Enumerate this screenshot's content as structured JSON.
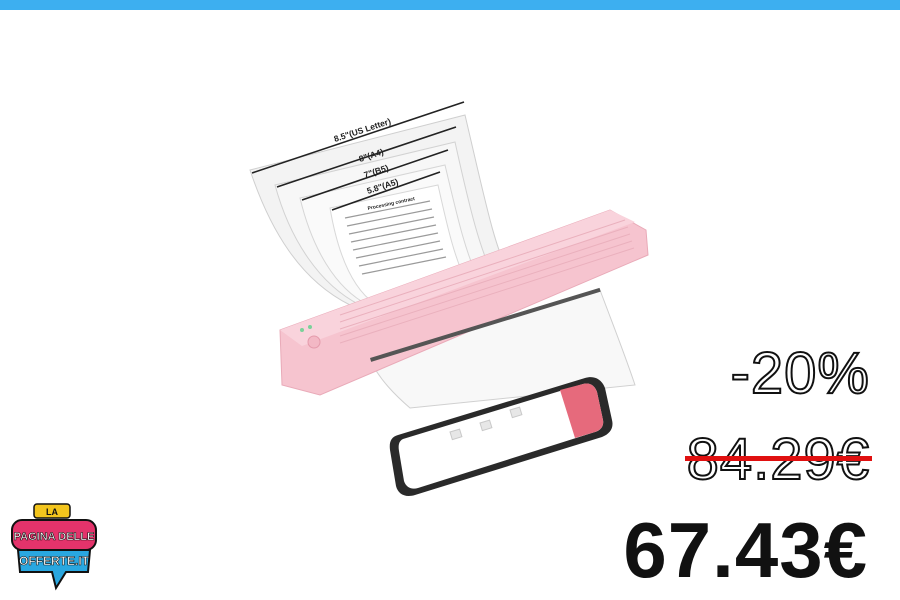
{
  "product": {
    "image_icon": "portable-printer-with-smartphone",
    "labels": {
      "us_letter": "8.5\"(US Letter)",
      "a4": "8\"(A4)",
      "b5": "7\"(B5)",
      "a5": "5.8\"(A5)",
      "doc_title": "Processing contract"
    }
  },
  "pricing": {
    "discount": "-20%",
    "old_price": "84.29€",
    "new_price": "67.43€"
  },
  "logo": {
    "line1": "LA",
    "line2": "PAGINA DELLE",
    "line3": "OFFERTE.IT"
  },
  "colors": {
    "topbar": "#3daff0",
    "strike": "#e01010",
    "printer": "#f6c4cf"
  }
}
